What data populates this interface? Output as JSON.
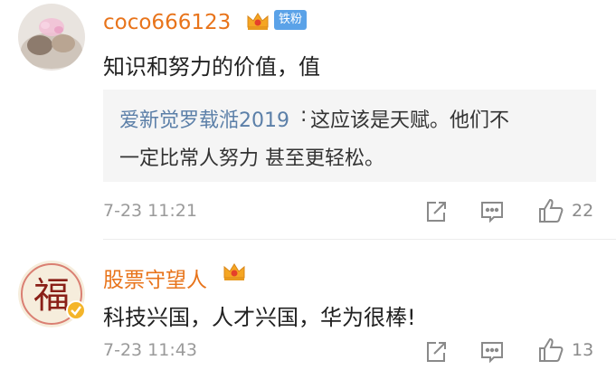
{
  "comments": [
    {
      "username": "coco666123",
      "fan_badge": "铁粉",
      "content": "知识和努力的价值，值",
      "reply": {
        "author": "爱新觉罗载湉2019",
        "colon": ":",
        "text_line1": "这应该是天赋。他们不",
        "text_line2": "一定比常人努力 甚至更轻松。"
      },
      "timestamp": "7-23 11:21",
      "likes": "22",
      "icons": [
        "crown-icon",
        "share-icon",
        "comment-icon",
        "like-icon"
      ]
    },
    {
      "username": "股票守望人",
      "content": "科技兴国，人才兴国，华为很棒!",
      "timestamp": "7-23 11:43",
      "likes": "13",
      "icons": [
        "crown-icon",
        "verified-icon",
        "share-icon",
        "comment-icon",
        "like-icon"
      ]
    }
  ],
  "colors": {
    "username": "#e8741b",
    "reply_author": "#5b7fa8",
    "fan_badge_bg": "#5aa2e8",
    "reply_bg": "#f5f5f5",
    "muted": "#9a9a9a"
  }
}
